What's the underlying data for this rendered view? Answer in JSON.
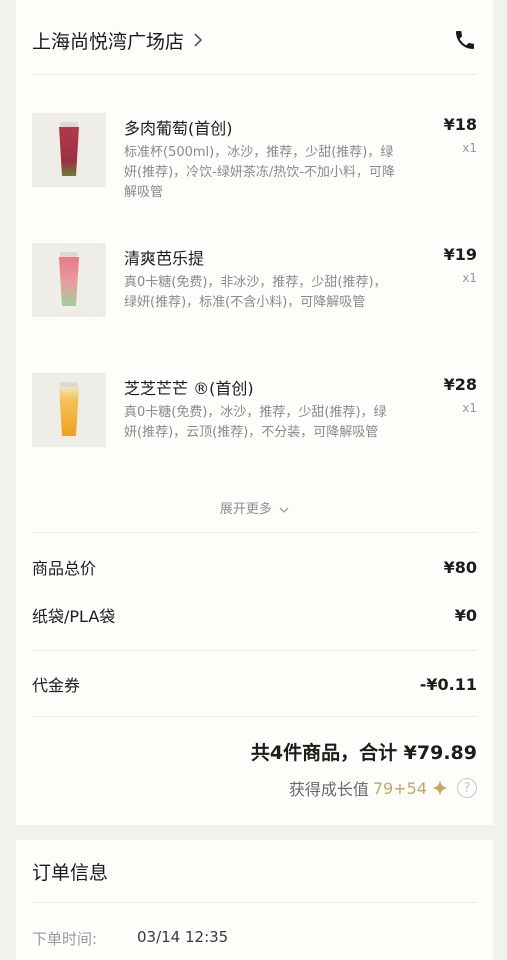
{
  "store": {
    "name": "上海尚悦湾广场店"
  },
  "items": [
    {
      "name": "多肉葡萄(首创)",
      "desc": "标准杯(500ml)，冰沙，推荐，少甜(推荐)，绿妍(推荐)，冷饮-绿妍茶冻/热饮-不加小料，可降解吸管",
      "price": "¥18",
      "qty": "x1",
      "color_top": "#b23a4a",
      "color_bottom": "#6e7a3a"
    },
    {
      "name": "清爽芭乐提",
      "desc": "真0卡糖(免费)，非冰沙，推荐，少甜(推荐)，绿妍(推荐)，标准(不含小料)，可降解吸管",
      "price": "¥19",
      "qty": "x1",
      "color_top": "#e87a86",
      "color_bottom": "#9fcf9a"
    },
    {
      "name": "芝芝芒芒 ®(首创)",
      "desc": "真0卡糖(免费)，冰沙，推荐，少甜(推荐)，绿妍(推荐)，云顶(推荐)，不分装，可降解吸管",
      "price": "¥28",
      "qty": "x1",
      "color_top": "#f4e7b8",
      "color_bottom": "#f0a020"
    }
  ],
  "expand_label": "展开更多",
  "summary": {
    "goods_total_label": "商品总价",
    "goods_total_value": "¥80",
    "bag_label": "纸袋/PLA袋",
    "bag_value": "¥0",
    "coupon_label": "代金券",
    "coupon_value": "-¥0.11"
  },
  "total_text": "共4件商品，合计 ¥79.89",
  "growth": {
    "label": "获得成长值",
    "value": "79+54",
    "help": "?"
  },
  "order_info": {
    "title": "订单信息",
    "time_label": "下单时间:",
    "time_value": "03/14 12:35"
  },
  "colors": {
    "background": "#f2f2ed",
    "card": "#fdfdf9",
    "gold": "#c8a465"
  },
  "icons": [
    "chevron-right-icon",
    "phone-icon",
    "chevron-down-icon",
    "sparkle-icon",
    "help-icon"
  ]
}
